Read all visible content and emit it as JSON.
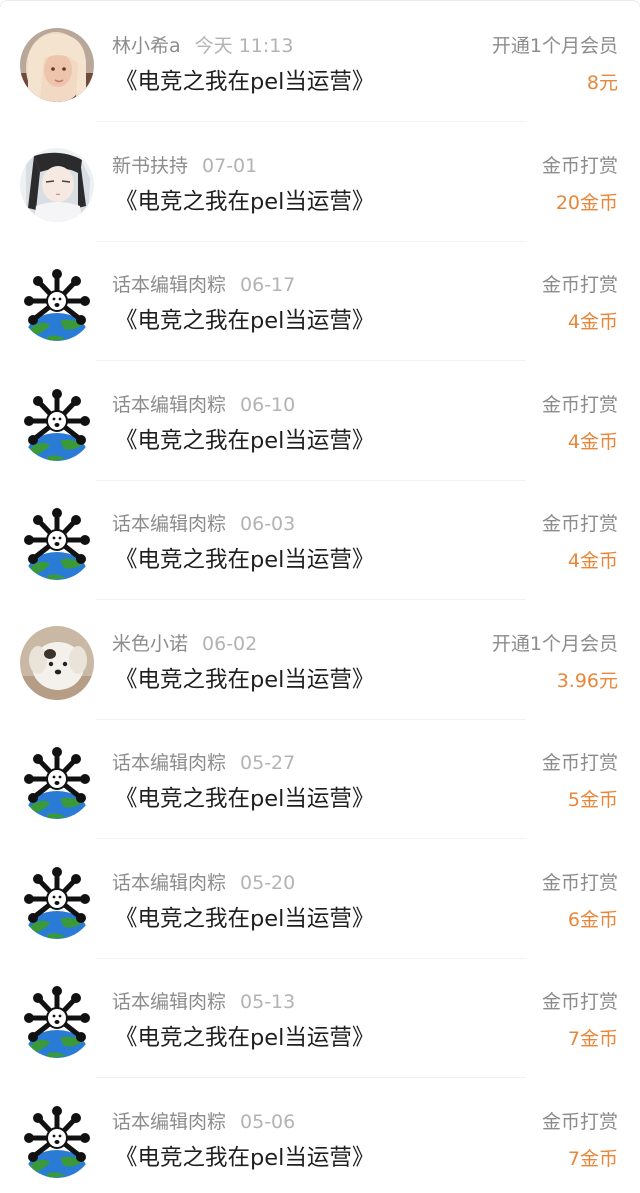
{
  "items": [
    {
      "user": "林小希a",
      "date": "今天 11:13",
      "book": "《电竞之我在pel当运营》",
      "type": "开通1个月会员",
      "amount": "8元",
      "avatar": "photo-girl-avatar"
    },
    {
      "user": "新书扶持",
      "date": "07-01",
      "book": "《电竞之我在pel当运营》",
      "type": "金币打赏",
      "amount": "20金币",
      "avatar": "anime-character-avatar"
    },
    {
      "user": "话本编辑肉粽",
      "date": "06-17",
      "book": "《电竞之我在pel当运营》",
      "type": "金币打赏",
      "amount": "4金币",
      "avatar": "earth-cartoon-avatar"
    },
    {
      "user": "话本编辑肉粽",
      "date": "06-10",
      "book": "《电竞之我在pel当运营》",
      "type": "金币打赏",
      "amount": "4金币",
      "avatar": "earth-cartoon-avatar"
    },
    {
      "user": "话本编辑肉粽",
      "date": "06-03",
      "book": "《电竞之我在pel当运营》",
      "type": "金币打赏",
      "amount": "4金币",
      "avatar": "earth-cartoon-avatar"
    },
    {
      "user": "米色小诺",
      "date": "06-02",
      "book": "《电竞之我在pel当运营》",
      "type": "开通1个月会员",
      "amount": "3.96元",
      "avatar": "puppy-photo-avatar"
    },
    {
      "user": "话本编辑肉粽",
      "date": "05-27",
      "book": "《电竞之我在pel当运营》",
      "type": "金币打赏",
      "amount": "5金币",
      "avatar": "earth-cartoon-avatar"
    },
    {
      "user": "话本编辑肉粽",
      "date": "05-20",
      "book": "《电竞之我在pel当运营》",
      "type": "金币打赏",
      "amount": "6金币",
      "avatar": "earth-cartoon-avatar"
    },
    {
      "user": "话本编辑肉粽",
      "date": "05-13",
      "book": "《电竞之我在pel当运营》",
      "type": "金币打赏",
      "amount": "7金币",
      "avatar": "earth-cartoon-avatar"
    },
    {
      "user": "话本编辑肉粽",
      "date": "05-06",
      "book": "《电竞之我在pel当运营》",
      "type": "金币打赏",
      "amount": "7金币",
      "avatar": "earth-cartoon-avatar"
    }
  ],
  "colors": {
    "amount": "#e8873a",
    "secondary_text": "#8c8c8c",
    "date_text": "#b3b3b3",
    "title_text": "#1f1f1f"
  }
}
